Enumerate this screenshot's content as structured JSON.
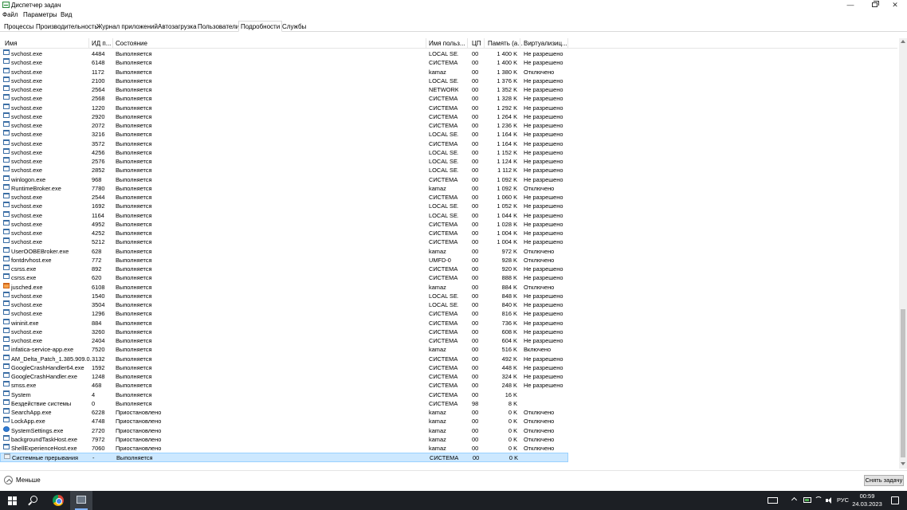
{
  "window": {
    "title": "Диспетчер задач",
    "min_glyph": "—",
    "close_glyph": "✕"
  },
  "menu": [
    "Файл",
    "Параметры",
    "Вид"
  ],
  "tabs": [
    {
      "label": "Процессы",
      "active": false
    },
    {
      "label": "Производительность",
      "active": false
    },
    {
      "label": "Журнал приложений",
      "active": false
    },
    {
      "label": "Автозагрузка",
      "active": false
    },
    {
      "label": "Пользователи",
      "active": false
    },
    {
      "label": "Подробности",
      "active": true
    },
    {
      "label": "Службы",
      "active": false
    }
  ],
  "columns": {
    "name": "Имя",
    "pid": "ИД п...",
    "state": "Состояние",
    "user": "Имя польз...",
    "cpu": "ЦП",
    "memory": "Память (а...",
    "virtualization": "Виртуализиц..."
  },
  "processes": [
    {
      "icon": "app",
      "name": "svchost.exe",
      "pid": "4484",
      "state": "Выполняется",
      "user": "LOCAL SE...",
      "cpu": "00",
      "mem": "1 400 K",
      "virt": "Не разрешено"
    },
    {
      "icon": "app",
      "name": "svchost.exe",
      "pid": "6148",
      "state": "Выполняется",
      "user": "СИСТЕМА",
      "cpu": "00",
      "mem": "1 400 K",
      "virt": "Не разрешено"
    },
    {
      "icon": "app",
      "name": "svchost.exe",
      "pid": "1172",
      "state": "Выполняется",
      "user": "kamaz",
      "cpu": "00",
      "mem": "1 380 K",
      "virt": "Отключено"
    },
    {
      "icon": "app",
      "name": "svchost.exe",
      "pid": "2100",
      "state": "Выполняется",
      "user": "LOCAL SE...",
      "cpu": "00",
      "mem": "1 376 K",
      "virt": "Не разрешено"
    },
    {
      "icon": "app",
      "name": "svchost.exe",
      "pid": "2564",
      "state": "Выполняется",
      "user": "NETWORK...",
      "cpu": "00",
      "mem": "1 352 K",
      "virt": "Не разрешено"
    },
    {
      "icon": "app",
      "name": "svchost.exe",
      "pid": "2568",
      "state": "Выполняется",
      "user": "СИСТЕМА",
      "cpu": "00",
      "mem": "1 328 K",
      "virt": "Не разрешено"
    },
    {
      "icon": "app",
      "name": "svchost.exe",
      "pid": "1220",
      "state": "Выполняется",
      "user": "СИСТЕМА",
      "cpu": "00",
      "mem": "1 292 K",
      "virt": "Не разрешено"
    },
    {
      "icon": "app",
      "name": "svchost.exe",
      "pid": "2920",
      "state": "Выполняется",
      "user": "СИСТЕМА",
      "cpu": "00",
      "mem": "1 264 K",
      "virt": "Не разрешено"
    },
    {
      "icon": "app",
      "name": "svchost.exe",
      "pid": "2072",
      "state": "Выполняется",
      "user": "СИСТЕМА",
      "cpu": "00",
      "mem": "1 236 K",
      "virt": "Не разрешено"
    },
    {
      "icon": "app",
      "name": "svchost.exe",
      "pid": "3216",
      "state": "Выполняется",
      "user": "LOCAL SE...",
      "cpu": "00",
      "mem": "1 164 K",
      "virt": "Не разрешено"
    },
    {
      "icon": "app",
      "name": "svchost.exe",
      "pid": "3572",
      "state": "Выполняется",
      "user": "СИСТЕМА",
      "cpu": "00",
      "mem": "1 164 K",
      "virt": "Не разрешено"
    },
    {
      "icon": "app",
      "name": "svchost.exe",
      "pid": "4256",
      "state": "Выполняется",
      "user": "LOCAL SE...",
      "cpu": "00",
      "mem": "1 152 K",
      "virt": "Не разрешено"
    },
    {
      "icon": "app",
      "name": "svchost.exe",
      "pid": "2576",
      "state": "Выполняется",
      "user": "LOCAL SE...",
      "cpu": "00",
      "mem": "1 124 K",
      "virt": "Не разрешено"
    },
    {
      "icon": "app",
      "name": "svchost.exe",
      "pid": "2852",
      "state": "Выполняется",
      "user": "LOCAL SE...",
      "cpu": "00",
      "mem": "1 112 K",
      "virt": "Не разрешено"
    },
    {
      "icon": "app",
      "name": "winlogon.exe",
      "pid": "968",
      "state": "Выполняется",
      "user": "СИСТЕМА",
      "cpu": "00",
      "mem": "1 092 K",
      "virt": "Не разрешено"
    },
    {
      "icon": "app",
      "name": "RuntimeBroker.exe",
      "pid": "7780",
      "state": "Выполняется",
      "user": "kamaz",
      "cpu": "00",
      "mem": "1 092 K",
      "virt": "Отключено"
    },
    {
      "icon": "app",
      "name": "svchost.exe",
      "pid": "2544",
      "state": "Выполняется",
      "user": "СИСТЕМА",
      "cpu": "00",
      "mem": "1 060 K",
      "virt": "Не разрешено"
    },
    {
      "icon": "app",
      "name": "svchost.exe",
      "pid": "1692",
      "state": "Выполняется",
      "user": "LOCAL SE...",
      "cpu": "00",
      "mem": "1 052 K",
      "virt": "Не разрешено"
    },
    {
      "icon": "app",
      "name": "svchost.exe",
      "pid": "1164",
      "state": "Выполняется",
      "user": "LOCAL SE...",
      "cpu": "00",
      "mem": "1 044 K",
      "virt": "Не разрешено"
    },
    {
      "icon": "app",
      "name": "svchost.exe",
      "pid": "4952",
      "state": "Выполняется",
      "user": "СИСТЕМА",
      "cpu": "00",
      "mem": "1 028 K",
      "virt": "Не разрешено"
    },
    {
      "icon": "app",
      "name": "svchost.exe",
      "pid": "4252",
      "state": "Выполняется",
      "user": "СИСТЕМА",
      "cpu": "00",
      "mem": "1 004 K",
      "virt": "Не разрешено"
    },
    {
      "icon": "app",
      "name": "svchost.exe",
      "pid": "5212",
      "state": "Выполняется",
      "user": "СИСТЕМА",
      "cpu": "00",
      "mem": "1 004 K",
      "virt": "Не разрешено"
    },
    {
      "icon": "app",
      "name": "UserOOBEBroker.exe",
      "pid": "628",
      "state": "Выполняется",
      "user": "kamaz",
      "cpu": "00",
      "mem": "972 K",
      "virt": "Отключено"
    },
    {
      "icon": "app",
      "name": "fontdrvhost.exe",
      "pid": "772",
      "state": "Выполняется",
      "user": "UMFD-0",
      "cpu": "00",
      "mem": "928 K",
      "virt": "Отключено"
    },
    {
      "icon": "app",
      "name": "csrss.exe",
      "pid": "892",
      "state": "Выполняется",
      "user": "СИСТЕМА",
      "cpu": "00",
      "mem": "920 K",
      "virt": "Не разрешено"
    },
    {
      "icon": "app",
      "name": "csrss.exe",
      "pid": "620",
      "state": "Выполняется",
      "user": "СИСТЕМА",
      "cpu": "00",
      "mem": "888 K",
      "virt": "Не разрешено"
    },
    {
      "icon": "java",
      "name": "jusched.exe",
      "pid": "6108",
      "state": "Выполняется",
      "user": "kamaz",
      "cpu": "00",
      "mem": "884 K",
      "virt": "Отключено"
    },
    {
      "icon": "app",
      "name": "svchost.exe",
      "pid": "1540",
      "state": "Выполняется",
      "user": "LOCAL SE...",
      "cpu": "00",
      "mem": "848 K",
      "virt": "Не разрешено"
    },
    {
      "icon": "app",
      "name": "svchost.exe",
      "pid": "3504",
      "state": "Выполняется",
      "user": "LOCAL SE...",
      "cpu": "00",
      "mem": "840 K",
      "virt": "Не разрешено"
    },
    {
      "icon": "app",
      "name": "svchost.exe",
      "pid": "1296",
      "state": "Выполняется",
      "user": "СИСТЕМА",
      "cpu": "00",
      "mem": "816 K",
      "virt": "Не разрешено"
    },
    {
      "icon": "app",
      "name": "wininit.exe",
      "pid": "884",
      "state": "Выполняется",
      "user": "СИСТЕМА",
      "cpu": "00",
      "mem": "736 K",
      "virt": "Не разрешено"
    },
    {
      "icon": "app",
      "name": "svchost.exe",
      "pid": "3260",
      "state": "Выполняется",
      "user": "СИСТЕМА",
      "cpu": "00",
      "mem": "608 K",
      "virt": "Не разрешено"
    },
    {
      "icon": "app",
      "name": "svchost.exe",
      "pid": "2404",
      "state": "Выполняется",
      "user": "СИСТЕМА",
      "cpu": "00",
      "mem": "604 K",
      "virt": "Не разрешено"
    },
    {
      "icon": "app",
      "name": "infatica-service-app.exe",
      "pid": "7520",
      "state": "Выполняется",
      "user": "kamaz",
      "cpu": "00",
      "mem": "516 K",
      "virt": "Включено"
    },
    {
      "icon": "app",
      "name": "AM_Delta_Patch_1.385.909.0...",
      "pid": "3132",
      "state": "Выполняется",
      "user": "СИСТЕМА",
      "cpu": "00",
      "mem": "492 K",
      "virt": "Не разрешено"
    },
    {
      "icon": "app",
      "name": "GoogleCrashHandler64.exe",
      "pid": "1592",
      "state": "Выполняется",
      "user": "СИСТЕМА",
      "cpu": "00",
      "mem": "448 K",
      "virt": "Не разрешено"
    },
    {
      "icon": "app",
      "name": "GoogleCrashHandler.exe",
      "pid": "1248",
      "state": "Выполняется",
      "user": "СИСТЕМА",
      "cpu": "00",
      "mem": "324 K",
      "virt": "Не разрешено"
    },
    {
      "icon": "app",
      "name": "smss.exe",
      "pid": "468",
      "state": "Выполняется",
      "user": "СИСТЕМА",
      "cpu": "00",
      "mem": "248 K",
      "virt": "Не разрешено"
    },
    {
      "icon": "app",
      "name": "System",
      "pid": "4",
      "state": "Выполняется",
      "user": "СИСТЕМА",
      "cpu": "00",
      "mem": "16 K",
      "virt": ""
    },
    {
      "icon": "app",
      "name": "Бездействие системы",
      "pid": "0",
      "state": "Выполняется",
      "user": "СИСТЕМА",
      "cpu": "98",
      "mem": "8 K",
      "virt": ""
    },
    {
      "icon": "app",
      "name": "SearchApp.exe",
      "pid": "6228",
      "state": "Приостановлено",
      "user": "kamaz",
      "cpu": "00",
      "mem": "0 K",
      "virt": "Отключено"
    },
    {
      "icon": "app",
      "name": "LockApp.exe",
      "pid": "4748",
      "state": "Приостановлено",
      "user": "kamaz",
      "cpu": "00",
      "mem": "0 K",
      "virt": "Отключено"
    },
    {
      "icon": "gear",
      "name": "SystemSettings.exe",
      "pid": "2720",
      "state": "Приостановлено",
      "user": "kamaz",
      "cpu": "00",
      "mem": "0 K",
      "virt": "Отключено"
    },
    {
      "icon": "app",
      "name": "backgroundTaskHost.exe",
      "pid": "7972",
      "state": "Приостановлено",
      "user": "kamaz",
      "cpu": "00",
      "mem": "0 K",
      "virt": "Отключено"
    },
    {
      "icon": "app",
      "name": "ShellExperienceHost.exe",
      "pid": "7060",
      "state": "Приостановлено",
      "user": "kamaz",
      "cpu": "00",
      "mem": "0 K",
      "virt": "Отключено"
    },
    {
      "icon": "blank",
      "name": "Системные прерывания",
      "pid": "-",
      "state": "Выполняется",
      "user": "СИСТЕМА",
      "cpu": "00",
      "mem": "0 K",
      "virt": "",
      "selected": true
    }
  ],
  "footer": {
    "less_label": "Меньше",
    "end_task_label": "Снять задачу"
  },
  "taskbar": {
    "language": "РУС",
    "time": "00:59",
    "date": "24.03.2023"
  }
}
